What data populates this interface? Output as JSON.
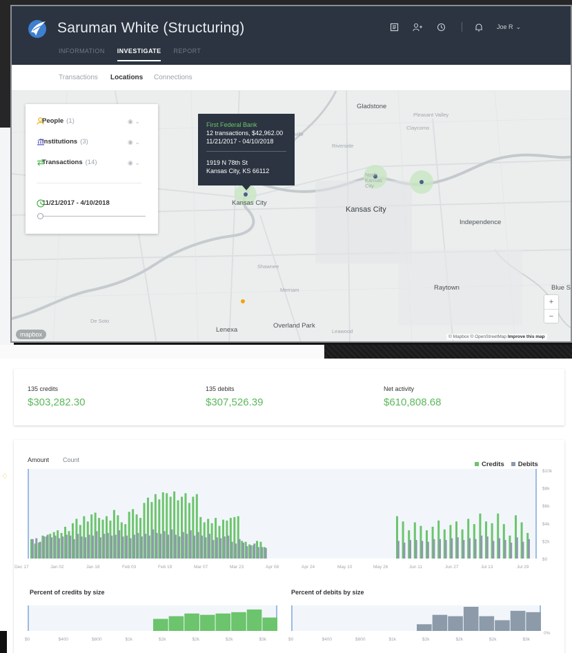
{
  "app": {
    "title": "Saruman White (Structuring)",
    "main_tabs": [
      {
        "label": "INFORMATION",
        "active": false
      },
      {
        "label": "INVESTIGATE",
        "active": true
      },
      {
        "label": "REPORT",
        "active": false
      }
    ],
    "user": "Joe R",
    "icons": [
      "notes-icon",
      "add-person-icon",
      "history-icon",
      "bell-icon"
    ]
  },
  "sub_tabs": [
    {
      "label": "Transactions",
      "active": false
    },
    {
      "label": "Locations",
      "active": true
    },
    {
      "label": "Connections",
      "active": false
    }
  ],
  "layers": {
    "items": [
      {
        "label": "People",
        "count": "(1)",
        "icon": "person-icon",
        "color": "#e7b416"
      },
      {
        "label": "Institutions",
        "count": "(3)",
        "icon": "bank-icon",
        "color": "#5a5fc8"
      },
      {
        "label": "Transactions",
        "count": "(14)",
        "icon": "transfer-icon",
        "color": "#49b34d"
      }
    ],
    "date_range": "11/21/2017 - 4/10/2018"
  },
  "tooltip": {
    "name": "First Federal Bank",
    "summary": "12 transactions, $42,962.00",
    "dates": "11/21/2017 - 04/10/2018",
    "address1": "1919 N 78th St",
    "address2": "Kansas City, KS 66112"
  },
  "map_labels": {
    "gladstone": "Gladstone",
    "pleasant_valley": "Pleasant Valley",
    "claycomo": "Claycomo",
    "riverside": "Riverside",
    "north_kc": "North Kansas City",
    "kc_ks": "Kansas City",
    "kc_mo": "Kansas City",
    "independence": "Independence",
    "shawnee": "Shawnee",
    "merriam": "Merriam",
    "raytown": "Raytown",
    "blue": "Blue S",
    "de_soto": "De Soto",
    "lenexa": "Lenexa",
    "overland_park": "Overland Park",
    "leawood": "Leawood",
    "ville": "ville"
  },
  "map_controls": {
    "zoom_in": "+",
    "zoom_out": "−",
    "logo": "mapbox",
    "attribution": "© Mapbox © OpenStreetMap",
    "improve": "Improve this map"
  },
  "stats": [
    {
      "label": "135 credits",
      "value": "$303,282.30"
    },
    {
      "label": "135 debits",
      "value": "$307,526.39"
    },
    {
      "label": "Net activity",
      "value": "$610,808.68"
    }
  ],
  "chart_tabs": [
    {
      "label": "Amount",
      "active": true
    },
    {
      "label": "Count",
      "active": false
    }
  ],
  "legend": [
    {
      "label": "Credits",
      "color": "#6cc46c"
    },
    {
      "label": "Debits",
      "color": "#8c9aaa"
    }
  ],
  "histogram_titles": {
    "credits": "Percent of credits by size",
    "debits": "Percent of debits by size"
  },
  "chart_data": [
    {
      "type": "bar",
      "title": "",
      "x_ticks": [
        "Dec 17",
        "Jan 02",
        "Jan 18",
        "Feb 03",
        "Feb 19",
        "Mar 07",
        "Mar 23",
        "Apr 08",
        "Apr 24",
        "May 10",
        "May 26",
        "Jun 11",
        "Jun 27",
        "Jul 13",
        "Jul 29"
      ],
      "y_ticks": [
        "$10k",
        "$8k",
        "$6k",
        "$4k",
        "$2k",
        "$0"
      ],
      "ylim": [
        0,
        10000
      ],
      "series": [
        {
          "name": "Credits",
          "color": "#6cc46c",
          "values": [
            2200,
            1700,
            1800,
            2600,
            2500,
            2800,
            3000,
            3200,
            2900,
            3600,
            3100,
            4000,
            4500,
            3800,
            4800,
            4200,
            5000,
            5200,
            4600,
            4400,
            4800,
            4300,
            5500,
            4900,
            4100,
            3900,
            5300,
            5600,
            5000,
            4600,
            6300,
            6900,
            6400,
            7300,
            6700,
            7500,
            7400,
            7000,
            7600,
            6600,
            7000,
            7400,
            6300,
            7000,
            7300,
            4700,
            4100,
            4500,
            4000,
            4600,
            3700,
            4400,
            4300,
            4600,
            4700,
            4800,
            2000,
            1900,
            1600,
            1500,
            2000,
            1900,
            1300,
            4800,
            4200,
            3200,
            4100,
            3700,
            3200,
            3600,
            4300,
            3300,
            3800,
            4200,
            3300,
            4500,
            3900,
            5100,
            4200,
            4000,
            5100,
            3900,
            2600,
            4900,
            4100,
            2900
          ],
          "gaps": "values are read left to right; the series has no bars between roughly Apr 24 and Jun 04"
        },
        {
          "name": "Debits",
          "color": "#8c9aaa",
          "values": [
            2200,
            2300,
            1900,
            2500,
            2700,
            2400,
            2600,
            2300,
            2500,
            2700,
            2600,
            2200,
            2800,
            2500,
            2400,
            2700,
            2600,
            3100,
            2400,
            2800,
            2900,
            2600,
            2700,
            3200,
            2500,
            2600,
            2300,
            2700,
            2900,
            2500,
            2800,
            2600,
            3300,
            2900,
            2800,
            3100,
            2700,
            3300,
            2700,
            2500,
            3000,
            2800,
            3200,
            2600,
            3000,
            2600,
            2400,
            2800,
            2100,
            2400,
            2300,
            2500,
            2600,
            1900,
            1700,
            2200,
            1800,
            1400,
            1500,
            1700,
            1300,
            1300,
            1200,
            2000,
            1800,
            2100,
            2100,
            2000,
            1900,
            2200,
            2200,
            2100,
            2300,
            2400,
            2100,
            2300,
            2200,
            2600,
            2500,
            2000,
            2300,
            2100,
            1800,
            2400,
            1900,
            2200
          ]
        }
      ]
    },
    {
      "type": "bar",
      "title": "Percent of credits by size",
      "x_ticks": [
        "$0",
        "$400",
        "$800",
        "$1k",
        "$2k",
        "$2k",
        "$2k",
        "$3k"
      ],
      "categories": [
        "b1",
        "b2",
        "b3",
        "b4",
        "b5",
        "b6",
        "b7",
        "b8",
        "b9",
        "b10",
        "b11",
        "b12",
        "b13",
        "b14",
        "b15",
        "b16"
      ],
      "values": [
        0,
        0,
        0,
        0,
        0,
        0,
        0,
        0,
        9,
        11,
        13,
        12,
        13,
        14,
        16,
        10
      ],
      "color": "#6cc46c"
    },
    {
      "type": "bar",
      "title": "Percent of debits by size",
      "x_ticks": [
        "$0",
        "$400",
        "$800",
        "$1k",
        "$2k",
        "$2k",
        "$2k",
        "$3k"
      ],
      "y_ticks": [
        "0%"
      ],
      "categories": [
        "b1",
        "b2",
        "b3",
        "b4",
        "b5",
        "b6",
        "b7",
        "b8",
        "b9",
        "b10",
        "b11",
        "b12",
        "b13",
        "b14",
        "b15",
        "b16"
      ],
      "values": [
        0,
        0,
        0,
        0,
        0,
        0,
        0,
        0,
        5,
        12,
        11,
        18,
        11,
        8,
        15,
        14
      ],
      "color": "#8c9aaa"
    }
  ]
}
